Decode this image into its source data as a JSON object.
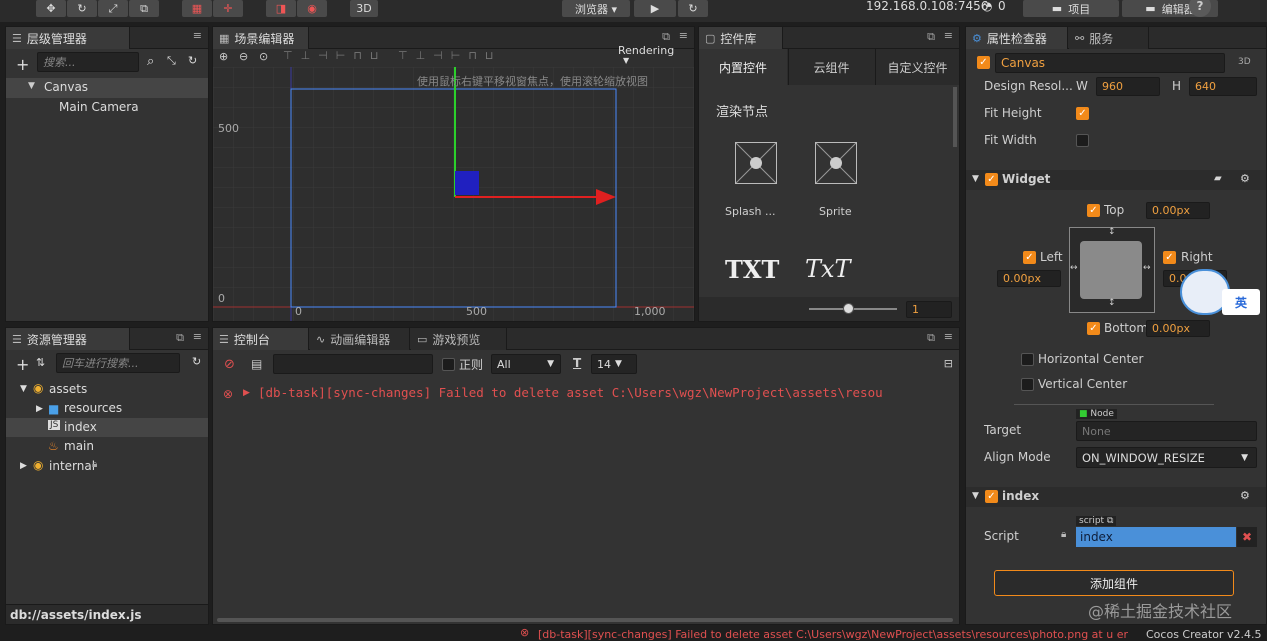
{
  "toolbar": {
    "browser_label": "浏览器 ▾",
    "mode_3d": "3D",
    "ip_text": "192.168.0.108:7456",
    "wifi_count": "0",
    "project_label": "项目",
    "editor_label": "编辑器",
    "help_label": "?"
  },
  "hierarchy": {
    "title": "层级管理器",
    "search_placeholder": "搜索...",
    "nodes": [
      "Canvas",
      "Main Camera"
    ]
  },
  "scene": {
    "title": "场景编辑器",
    "rendering": "Rendering",
    "hint": "使用鼠标右键平移视窗焦点，使用滚轮缩放视图",
    "y500": "500",
    "y0": "0",
    "x0": "0",
    "x500": "500",
    "x1000": "1,000"
  },
  "controls_lib": {
    "title": "控件库",
    "tabs": [
      "内置控件",
      "云组件",
      "自定义控件"
    ],
    "section": "渲染节点",
    "items": [
      "Splash ...",
      "Sprite"
    ],
    "txt1": "TXT",
    "txt2": "TxT",
    "zoom_value": "1"
  },
  "assets": {
    "title": "资源管理器",
    "search_placeholder": "回车进行搜索...",
    "tree": [
      "assets",
      "resources",
      "index",
      "main",
      "internal"
    ],
    "path": "db://assets/index.js"
  },
  "console": {
    "tabs": [
      "控制台",
      "动画编辑器",
      "游戏预览"
    ],
    "regex_label": "正则",
    "level": "All",
    "font_size": "14",
    "error_line": "[db-task][sync-changes] Failed to delete asset C:\\Users\\wgz\\NewProject\\assets\\resou"
  },
  "inspector": {
    "tabs": [
      "属性检查器",
      "服务"
    ],
    "node_name": "Canvas",
    "badge_3d": "3D",
    "design_res_label": "Design Resol...",
    "w_label": "W",
    "w_value": "960",
    "h_label": "H",
    "h_value": "640",
    "fit_height": "Fit Height",
    "fit_width": "Fit Width",
    "widget_title": "Widget",
    "top_label": "Top",
    "top_value": "0.00px",
    "left_label": "Left",
    "left_value": "0.00px",
    "right_label": "Right",
    "right_value": "0.0",
    "bottom_label": "Bottom",
    "bottom_value": "0.00px",
    "hcenter": "Horizontal Center",
    "vcenter": "Vertical Center",
    "target_tag": "Node",
    "target_label": "Target",
    "target_value": "None",
    "align_mode_label": "Align Mode",
    "align_mode_value": "ON_WINDOW_RESIZE",
    "script_comp_title": "index",
    "script_tag": "script",
    "script_label": "Script",
    "script_value": "index",
    "add_component": "添加组件",
    "ime_label": "英"
  },
  "status": {
    "error_text": "[db-task][sync-changes] Failed to delete asset C:\\Users\\wgz\\NewProject\\assets\\resources\\photo.png at u error",
    "version": "Cocos Creator v2.4.5",
    "watermark": "@稀土掘金技术社区"
  },
  "colors": {
    "accent": "#f28a1a",
    "error": "#e05050",
    "selection": "#4a90d9"
  }
}
